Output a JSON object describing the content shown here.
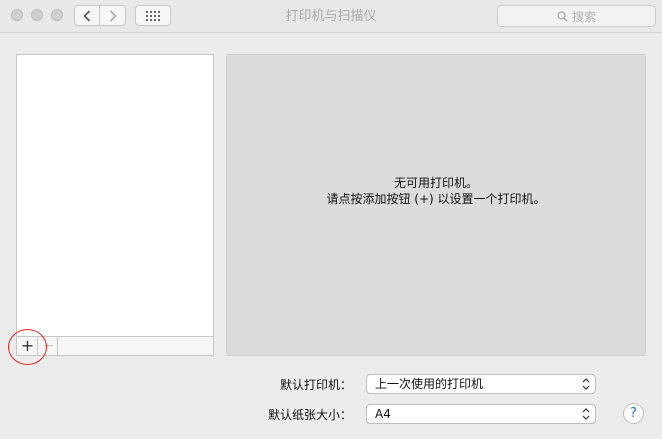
{
  "window": {
    "title": "打印机与扫描仪"
  },
  "search": {
    "placeholder": "搜索",
    "icon": "search-icon"
  },
  "printer_list": {
    "items": [],
    "add_label": "+",
    "remove_label": "−"
  },
  "detail": {
    "line1": "无可用打印机。",
    "line2": "请点按添加按钮 (+) 以设置一个打印机。"
  },
  "settings": {
    "default_printer_label": "默认打印机：",
    "default_printer_value": "上一次使用的打印机",
    "default_paper_label": "默认纸张大小：",
    "default_paper_value": "A4"
  },
  "help": {
    "label": "?"
  },
  "colors": {
    "annotation_circle": "#e02020",
    "help_accent": "#2a6fdb"
  }
}
